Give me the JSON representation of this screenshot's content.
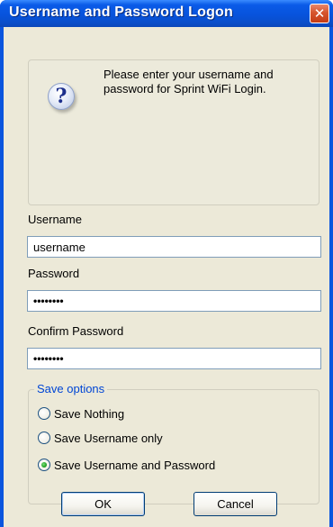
{
  "window": {
    "title": "Username and Password Logon",
    "close_symbol": "✕"
  },
  "info": {
    "icon": "question-icon",
    "icon_glyph": "?",
    "message": "Please enter your username and password for Sprint WiFi Login."
  },
  "form": {
    "username_label": "Username",
    "username_value": "username",
    "password_label": "Password",
    "password_value": "••••••••",
    "confirm_label": "Confirm Password",
    "confirm_value": "••••••••"
  },
  "save_options": {
    "legend": "Save options",
    "options": [
      {
        "label": "Save Nothing",
        "selected": false
      },
      {
        "label": "Save Username only",
        "selected": false
      },
      {
        "label": "Save Username and Password",
        "selected": true
      }
    ]
  },
  "buttons": {
    "ok_label": "OK",
    "cancel_label": "Cancel"
  },
  "colors": {
    "titlebar": "#0753dc",
    "dialog_bg": "#ece9d8",
    "legend": "#0046d5",
    "close_button": "#d6552d"
  }
}
